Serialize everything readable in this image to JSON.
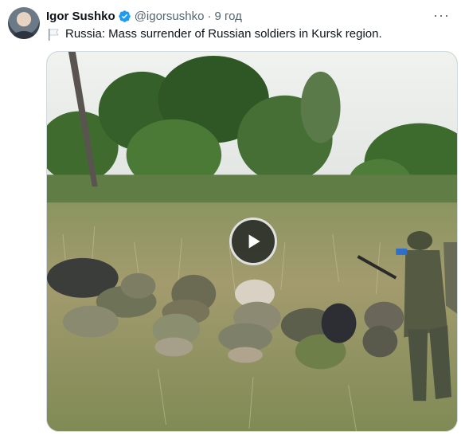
{
  "tweet": {
    "author_name": "Igor Sushko",
    "handle": "@igorsushko",
    "separator": "·",
    "time": "9 год",
    "text": "Russia: Mass surrender of Russian soldiers in Kursk region.",
    "more_label": "···"
  },
  "icons": {
    "verified": "verified-badge-icon",
    "flag": "white-flag-icon",
    "play": "play-icon",
    "more": "more-icon"
  },
  "colors": {
    "verified_blue": "#1d9bf0",
    "text": "#0f1419",
    "secondary_text": "#536471"
  }
}
